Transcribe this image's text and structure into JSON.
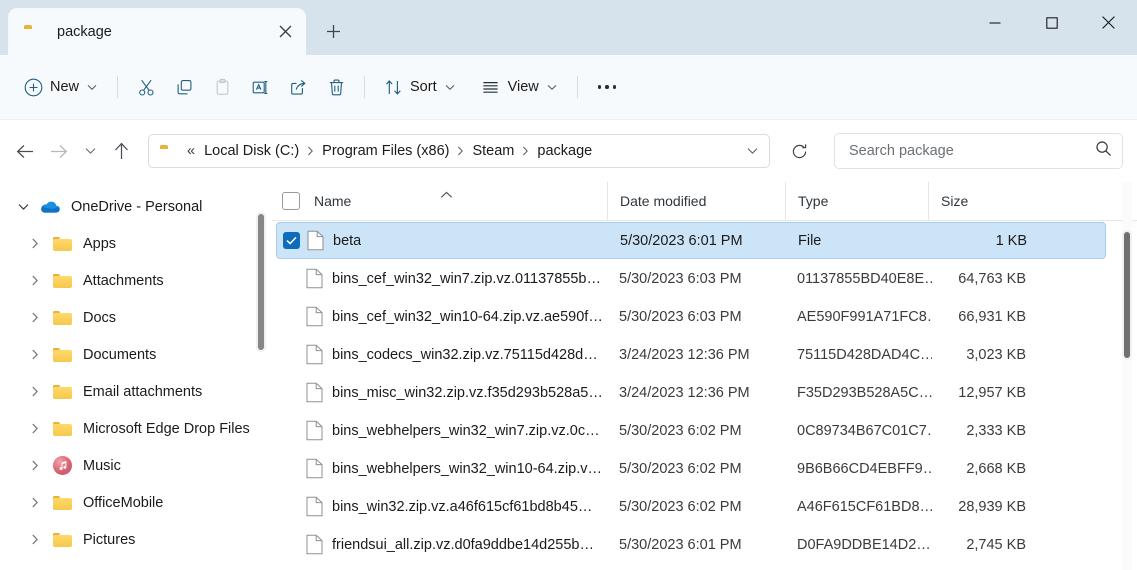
{
  "window": {
    "tab_title": "package",
    "controls": {
      "minimize": "minimize",
      "maximize": "maximize",
      "close": "close"
    },
    "new_tab_label": "+"
  },
  "toolbar": {
    "new_label": "New",
    "cut_label": "Cut",
    "copy_label": "Copy",
    "paste_label": "Paste",
    "rename_label": "Rename",
    "share_label": "Share",
    "delete_label": "Delete",
    "sort_label": "Sort",
    "view_label": "View",
    "more_label": "See more"
  },
  "address": {
    "back_label": "Back",
    "forward_label": "Forward",
    "recent_label": "Recent locations",
    "up_label": "Up to Steam",
    "prefix": "«",
    "crumbs": [
      "Local Disk (C:)",
      "Program Files (x86)",
      "Steam",
      "package"
    ],
    "separator": "›",
    "refresh_label": "Refresh"
  },
  "search": {
    "placeholder": "Search package",
    "value": ""
  },
  "sidebar": {
    "items": [
      {
        "label": "OneDrive - Personal",
        "icon": "onedrive-cloud-icon",
        "level": "root",
        "expanded": true
      },
      {
        "label": "Apps",
        "icon": "folder-icon",
        "level": "child",
        "expanded": false
      },
      {
        "label": "Attachments",
        "icon": "folder-icon",
        "level": "child",
        "expanded": false
      },
      {
        "label": "Docs",
        "icon": "folder-icon",
        "level": "child",
        "expanded": false
      },
      {
        "label": "Documents",
        "icon": "folder-icon",
        "level": "child",
        "expanded": false
      },
      {
        "label": "Email attachments",
        "icon": "folder-icon",
        "level": "child",
        "expanded": false
      },
      {
        "label": "Microsoft Edge Drop Files",
        "icon": "folder-icon",
        "level": "child",
        "expanded": false
      },
      {
        "label": "Music",
        "icon": "music-icon",
        "level": "child",
        "expanded": false
      },
      {
        "label": "OfficeMobile",
        "icon": "folder-icon",
        "level": "child",
        "expanded": false
      },
      {
        "label": "Pictures",
        "icon": "folder-icon",
        "level": "child",
        "expanded": false
      }
    ]
  },
  "filelist": {
    "columns": [
      "Name",
      "Date modified",
      "Type",
      "Size"
    ],
    "sort_column": "Name",
    "sort_direction": "ascending",
    "select_all_checked": false,
    "rows": [
      {
        "name": "beta",
        "date": "5/30/2023 6:01 PM",
        "type": "File",
        "size": "1 KB",
        "selected": true
      },
      {
        "name": "bins_cef_win32_win7.zip.vz.01137855b…",
        "date": "5/30/2023 6:03 PM",
        "type": "01137855BD40E8E…",
        "size": "64,763 KB",
        "selected": false
      },
      {
        "name": "bins_cef_win32_win10-64.zip.vz.ae590f…",
        "date": "5/30/2023 6:03 PM",
        "type": "AE590F991A71FC8…",
        "size": "66,931 KB",
        "selected": false
      },
      {
        "name": "bins_codecs_win32.zip.vz.75115d428d…",
        "date": "3/24/2023 12:36 PM",
        "type": "75115D428DAD4C…",
        "size": "3,023 KB",
        "selected": false
      },
      {
        "name": "bins_misc_win32.zip.vz.f35d293b528a5…",
        "date": "3/24/2023 12:36 PM",
        "type": "F35D293B528A5C…",
        "size": "12,957 KB",
        "selected": false
      },
      {
        "name": "bins_webhelpers_win32_win7.zip.vz.0c…",
        "date": "5/30/2023 6:02 PM",
        "type": "0C89734B67C01C7…",
        "size": "2,333 KB",
        "selected": false
      },
      {
        "name": "bins_webhelpers_win32_win10-64.zip.v…",
        "date": "5/30/2023 6:02 PM",
        "type": "9B6B66CD4EBFF9…",
        "size": "2,668 KB",
        "selected": false
      },
      {
        "name": "bins_win32.zip.vz.a46f615cf61bd8b45…",
        "date": "5/30/2023 6:02 PM",
        "type": "A46F615CF61BD8…",
        "size": "28,939 KB",
        "selected": false
      },
      {
        "name": "friendsui_all.zip.vz.d0fa9ddbe14d255b…",
        "date": "5/30/2023 6:01 PM",
        "type": "D0FA9DDBE14D2…",
        "size": "2,745 KB",
        "selected": false
      }
    ]
  },
  "colors": {
    "titlebar": "#d6e2ec",
    "toolbar": "#f7fafd",
    "selection": "#cce4f7",
    "checkbox_accent": "#0f6cbd",
    "folder_yellow": "#ffd96b"
  }
}
